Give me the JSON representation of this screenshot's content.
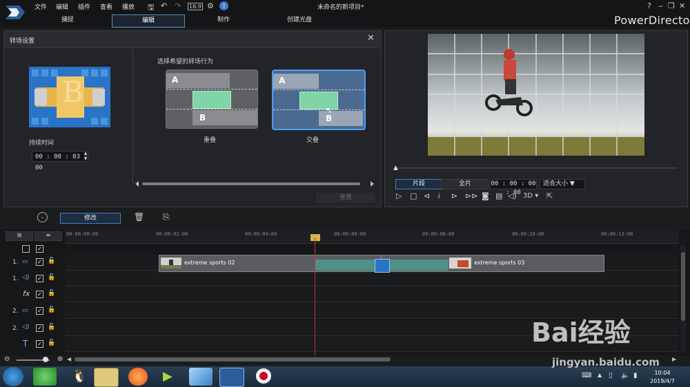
{
  "menu": [
    "文件",
    "编辑",
    "插件",
    "查看",
    "播放"
  ],
  "project_title": "未命名的新项目*",
  "brand": "PowerDirector",
  "tabs": [
    "捕捉",
    "编辑",
    "制作",
    "创建光盘"
  ],
  "transition_panel": {
    "title": "转场设置",
    "duration_label": "持续时间",
    "duration_value": "00 : 00 : 03 : 00",
    "choose_label": "选择希望的转场行为",
    "options": [
      {
        "label": "重叠",
        "a": "A",
        "b": "B",
        "selected": false
      },
      {
        "label": "交叠",
        "a": "A",
        "b": "B",
        "selected": true
      }
    ],
    "thumb_letter": "B",
    "reset_label": "重置"
  },
  "preview": {
    "clip_button": "片段",
    "full_button": "全片",
    "timecode": "00 : 00 : 00 : 00",
    "fit_label": "适合大小",
    "mode_3d": "3D"
  },
  "toolbar": {
    "modify_label": "修改"
  },
  "timeline": {
    "ruler": [
      "00:00:00:00",
      "00:00:02:00",
      "00:00:04:00",
      "00:00:06:00",
      "00:00:08:00",
      "00:00:10:00",
      "00:00:12:00"
    ],
    "tracks": [
      {
        "label": "1.",
        "icon": "video-icon"
      },
      {
        "label": "1.",
        "icon": "audio-icon"
      },
      {
        "label": "fx",
        "icon": "fx-icon"
      },
      {
        "label": "2.",
        "icon": "video-icon"
      },
      {
        "label": "2.",
        "icon": "audio-icon"
      },
      {
        "label": "T",
        "icon": "title-icon"
      }
    ],
    "clips": [
      "extreme sports 02",
      "extreme sports 03"
    ]
  },
  "taskbar": {
    "time": "10:04",
    "date": "2019/4/7"
  },
  "watermark": {
    "text": "Bai经验",
    "url": "jingyan.baidu.com"
  }
}
